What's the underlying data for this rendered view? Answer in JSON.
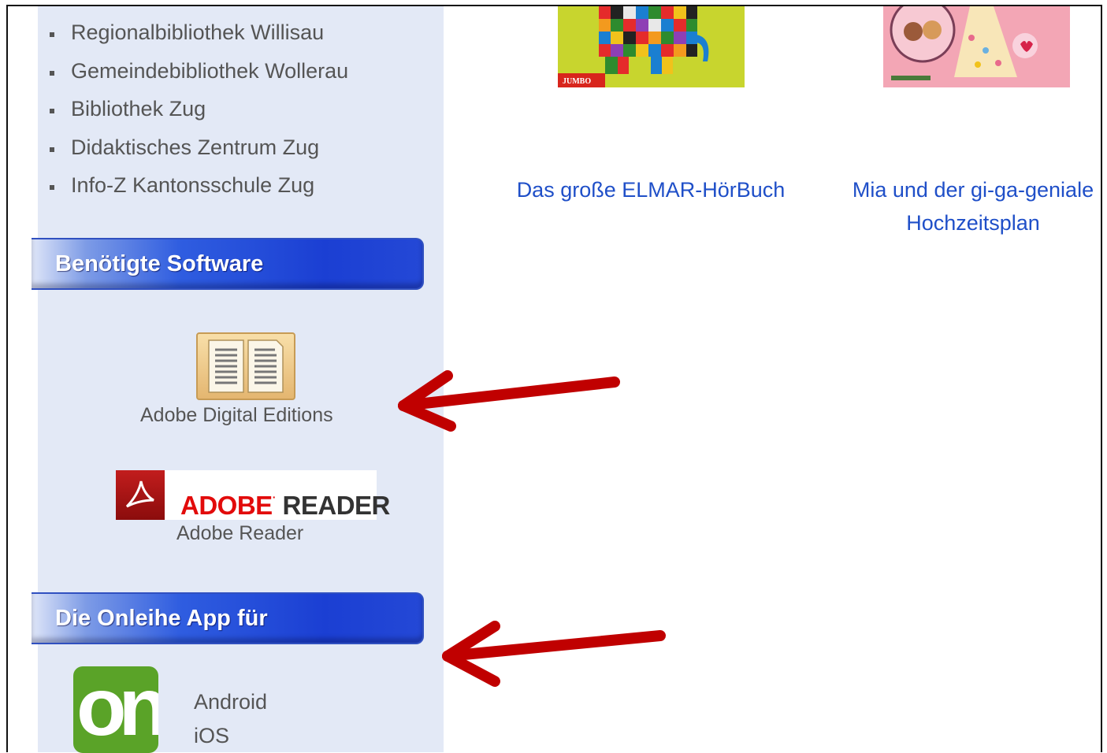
{
  "sidebar": {
    "libraries": [
      "Regionalbibliothek Willisau",
      "Gemeindebibliothek Wollerau",
      "Bibliothek Zug",
      "Didaktisches Zentrum Zug",
      "Info-Z Kantonsschule Zug"
    ],
    "software_heading": "Benötigte Software",
    "software": [
      {
        "label": "Adobe Digital Editions",
        "icon": "book-icon"
      },
      {
        "label": "Adobe Reader",
        "icon": "adobe-reader-icon",
        "logo_text_1": "ADOBE",
        "logo_text_2": "READER"
      }
    ],
    "app_heading": "Die Onleihe App für",
    "app_icon_text": "on",
    "app_links": [
      "Android",
      "iOS"
    ]
  },
  "main": {
    "books": [
      {
        "title": "Das große ELMAR-HörBuch",
        "cover_text": "JUMBO"
      },
      {
        "title_line1": "Mia und der gi-ga-geniale",
        "title_line2": "Hochzeitsplan"
      }
    ]
  },
  "colors": {
    "sidebar_bg": "#e3e9f6",
    "heading_blue": "#1b3fd3",
    "link_blue": "#1f4fc8",
    "arrow_red": "#c00000",
    "onleihe_green": "#5aa328"
  }
}
